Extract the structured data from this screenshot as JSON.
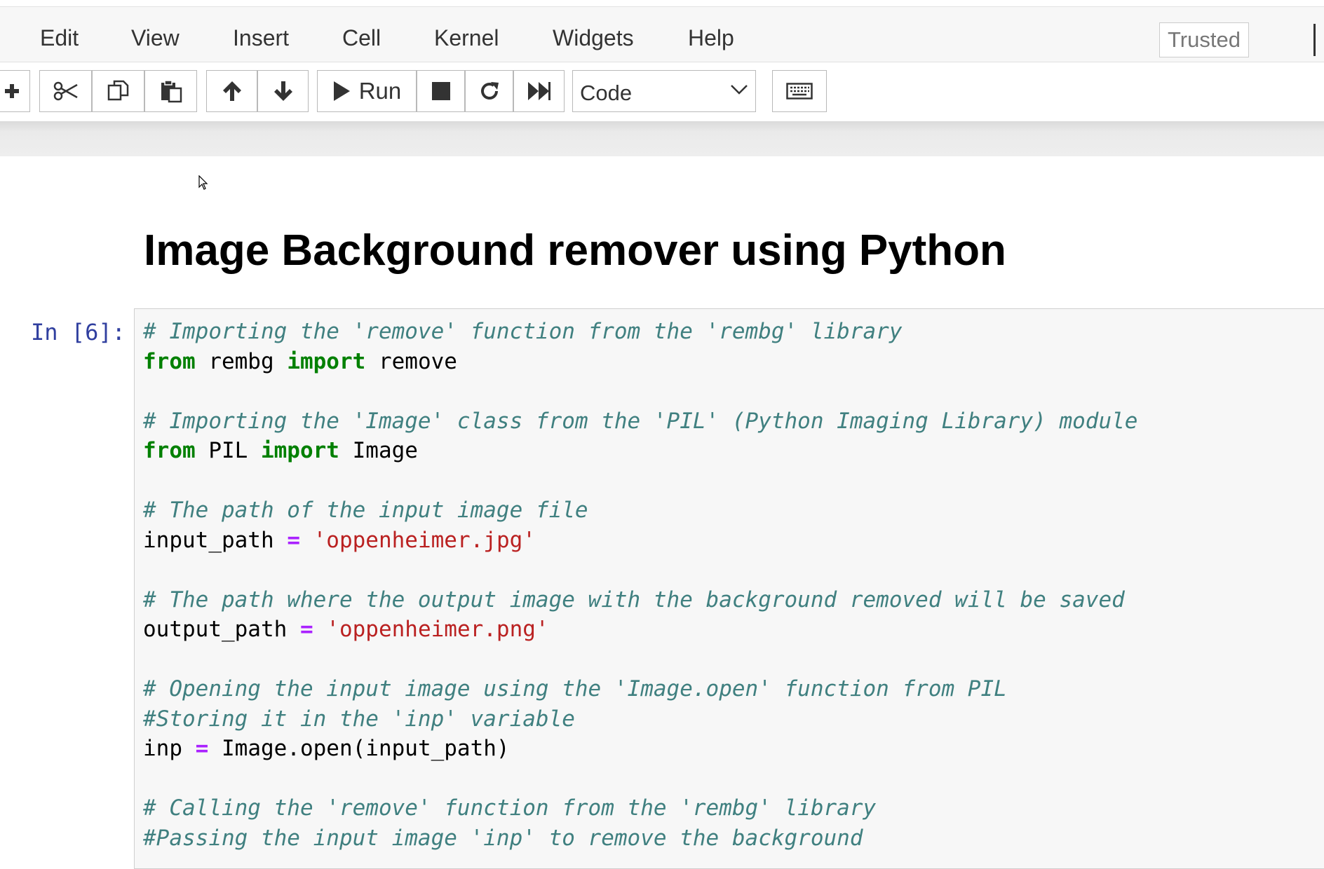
{
  "menu": {
    "items": [
      "Edit",
      "View",
      "Insert",
      "Cell",
      "Kernel",
      "Widgets",
      "Help"
    ],
    "trusted": "Trusted"
  },
  "toolbar": {
    "run_label": "Run",
    "cell_type": "Code",
    "icons": [
      "plus-icon",
      "cut-icon",
      "copy-icon",
      "paste-icon",
      "arrow-up-icon",
      "arrow-down-icon",
      "play-icon",
      "stop-icon",
      "restart-icon",
      "fast-forward-icon",
      "chevron-down-icon",
      "keyboard-icon"
    ]
  },
  "notebook": {
    "heading": "Image Background remover using Python",
    "cell": {
      "prompt": "In [6]:",
      "code": {
        "c1": "# Importing the 'remove' function from the 'rembg' library",
        "l2_kw1": "from",
        "l2_mod": " rembg ",
        "l2_kw2": "import",
        "l2_name": " remove",
        "c4": "# Importing the 'Image' class from the 'PIL' (Python Imaging Library) module",
        "l5_kw1": "from",
        "l5_mod": " PIL ",
        "l5_kw2": "import",
        "l5_name": " Image",
        "c7": "# The path of the input image file",
        "l8_var": "input_path ",
        "l8_op": "=",
        "l8_str": " 'oppenheimer.jpg'",
        "c10": "# The path where the output image with the background removed will be saved",
        "l11_var": "output_path ",
        "l11_op": "=",
        "l11_str": " 'oppenheimer.png'",
        "c13": "# Opening the input image using the 'Image.open' function from PIL",
        "c14": "#Storing it in the 'inp' variable",
        "l15_var": "inp ",
        "l15_op": "=",
        "l15_rest": " Image.open(input_path)",
        "c17": "# Calling the 'remove' function from the 'rembg' library",
        "c18": "#Passing the input image 'inp' to remove the background"
      }
    }
  }
}
